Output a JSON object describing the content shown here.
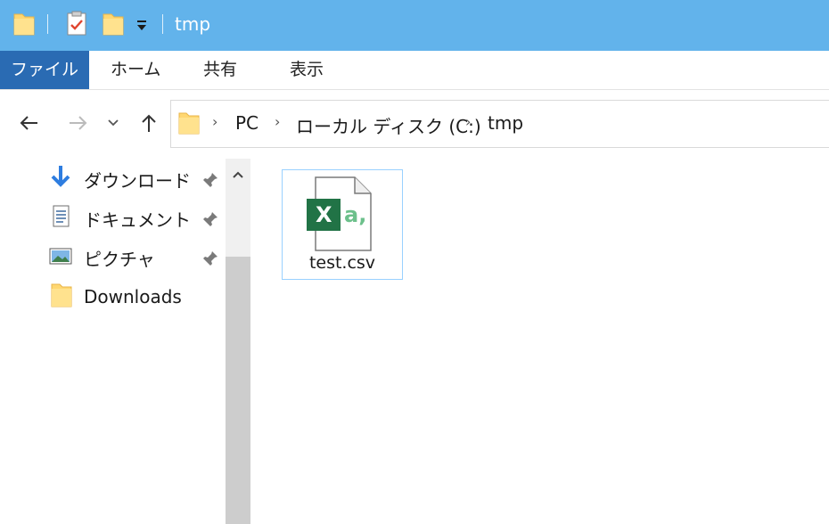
{
  "window": {
    "title": "tmp"
  },
  "ribbon": {
    "tabs": [
      "ファイル",
      "ホーム",
      "共有",
      "表示"
    ]
  },
  "address": {
    "crumbs": [
      "PC",
      "ローカル ディスク (C:)",
      "tmp"
    ]
  },
  "sidebar": {
    "items": [
      {
        "label": "ダウンロード",
        "icon": "download-arrow-icon",
        "pinned": true
      },
      {
        "label": "ドキュメント",
        "icon": "document-icon",
        "pinned": true
      },
      {
        "label": "ピクチャ",
        "icon": "pictures-icon",
        "pinned": true
      },
      {
        "label": "Downloads",
        "icon": "folder-icon",
        "pinned": false
      }
    ]
  },
  "files": [
    {
      "name": "test.csv",
      "icon": "excel-csv-icon"
    }
  ],
  "colors": {
    "titlebar": "#62b3eb",
    "file_tab": "#2a6bb3",
    "selection_border": "#99d1ff",
    "excel_green": "#217346"
  }
}
